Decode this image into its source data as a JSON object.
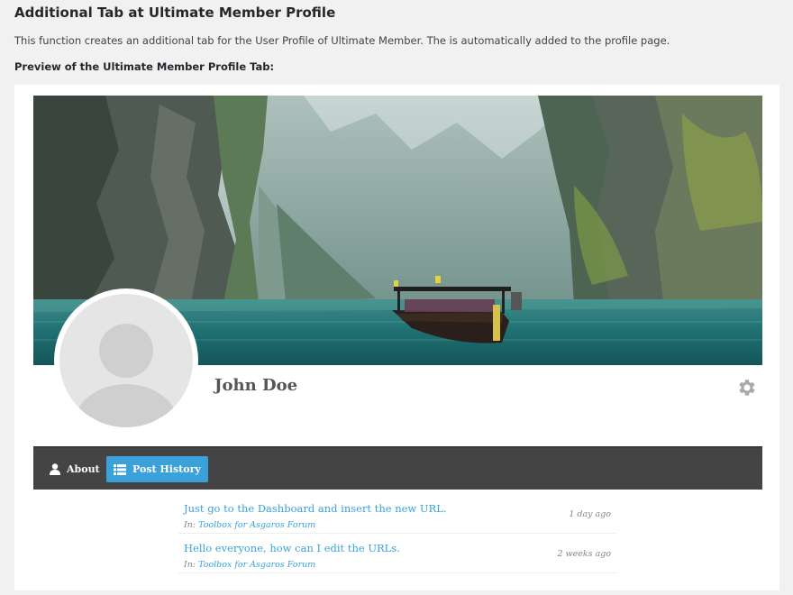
{
  "header": {
    "title": "Additional Tab at Ultimate Member Profile",
    "description": "This function creates an additional tab for the User Profile of Ultimate Member. The is automatically added to the profile page.",
    "preview_label": "Preview of the Ultimate Member Profile Tab:"
  },
  "profile": {
    "name": "John Doe",
    "cover_image": "lake-boat-cliffs",
    "avatar_icon": "default-user-avatar"
  },
  "nav": {
    "about_label": "About",
    "post_history_label": "Post History",
    "active_color": "#3ba1da"
  },
  "posts": [
    {
      "title": "Just go to the Dashboard and insert the new URL.",
      "in_prefix": "In:",
      "forum": "Toolbox for Asgaros Forum",
      "time": "1 day ago"
    },
    {
      "title": "Hello everyone, how can I edit the URLs.",
      "in_prefix": "In:",
      "forum": "Toolbox for Asgaros Forum",
      "time": "2 weeks ago"
    }
  ]
}
